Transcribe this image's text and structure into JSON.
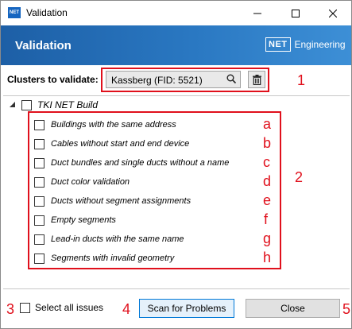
{
  "window": {
    "title": "Validation",
    "app_icon_text": "NET"
  },
  "header": {
    "title": "Validation",
    "logo_box": "NET",
    "logo_text": "Engineering"
  },
  "cluster": {
    "label": "Clusters to validate:",
    "value": "Kassberg (FID: 5521)"
  },
  "tree": {
    "root_label": "TKI NET Build",
    "items": [
      {
        "label": "Buildings with the same address",
        "mark": "a"
      },
      {
        "label": "Cables without start and end device",
        "mark": "b"
      },
      {
        "label": "Duct bundles and single ducts without a name",
        "mark": "c"
      },
      {
        "label": "Duct color validation",
        "mark": "d"
      },
      {
        "label": "Ducts without segment assignments",
        "mark": "e"
      },
      {
        "label": "Empty segments",
        "mark": "f"
      },
      {
        "label": "Lead-in ducts with the same name",
        "mark": "g"
      },
      {
        "label": "Segments with invalid geometry",
        "mark": "h"
      }
    ]
  },
  "footer": {
    "select_all_label": "Select all issues",
    "scan_label": "Scan for Problems",
    "close_label": "Close"
  },
  "annotations": {
    "m1": "1",
    "m2": "2",
    "m3": "3",
    "m4": "4",
    "m5": "5"
  },
  "colors": {
    "accent": "#1d5fa6",
    "annotation": "#e0101c"
  }
}
